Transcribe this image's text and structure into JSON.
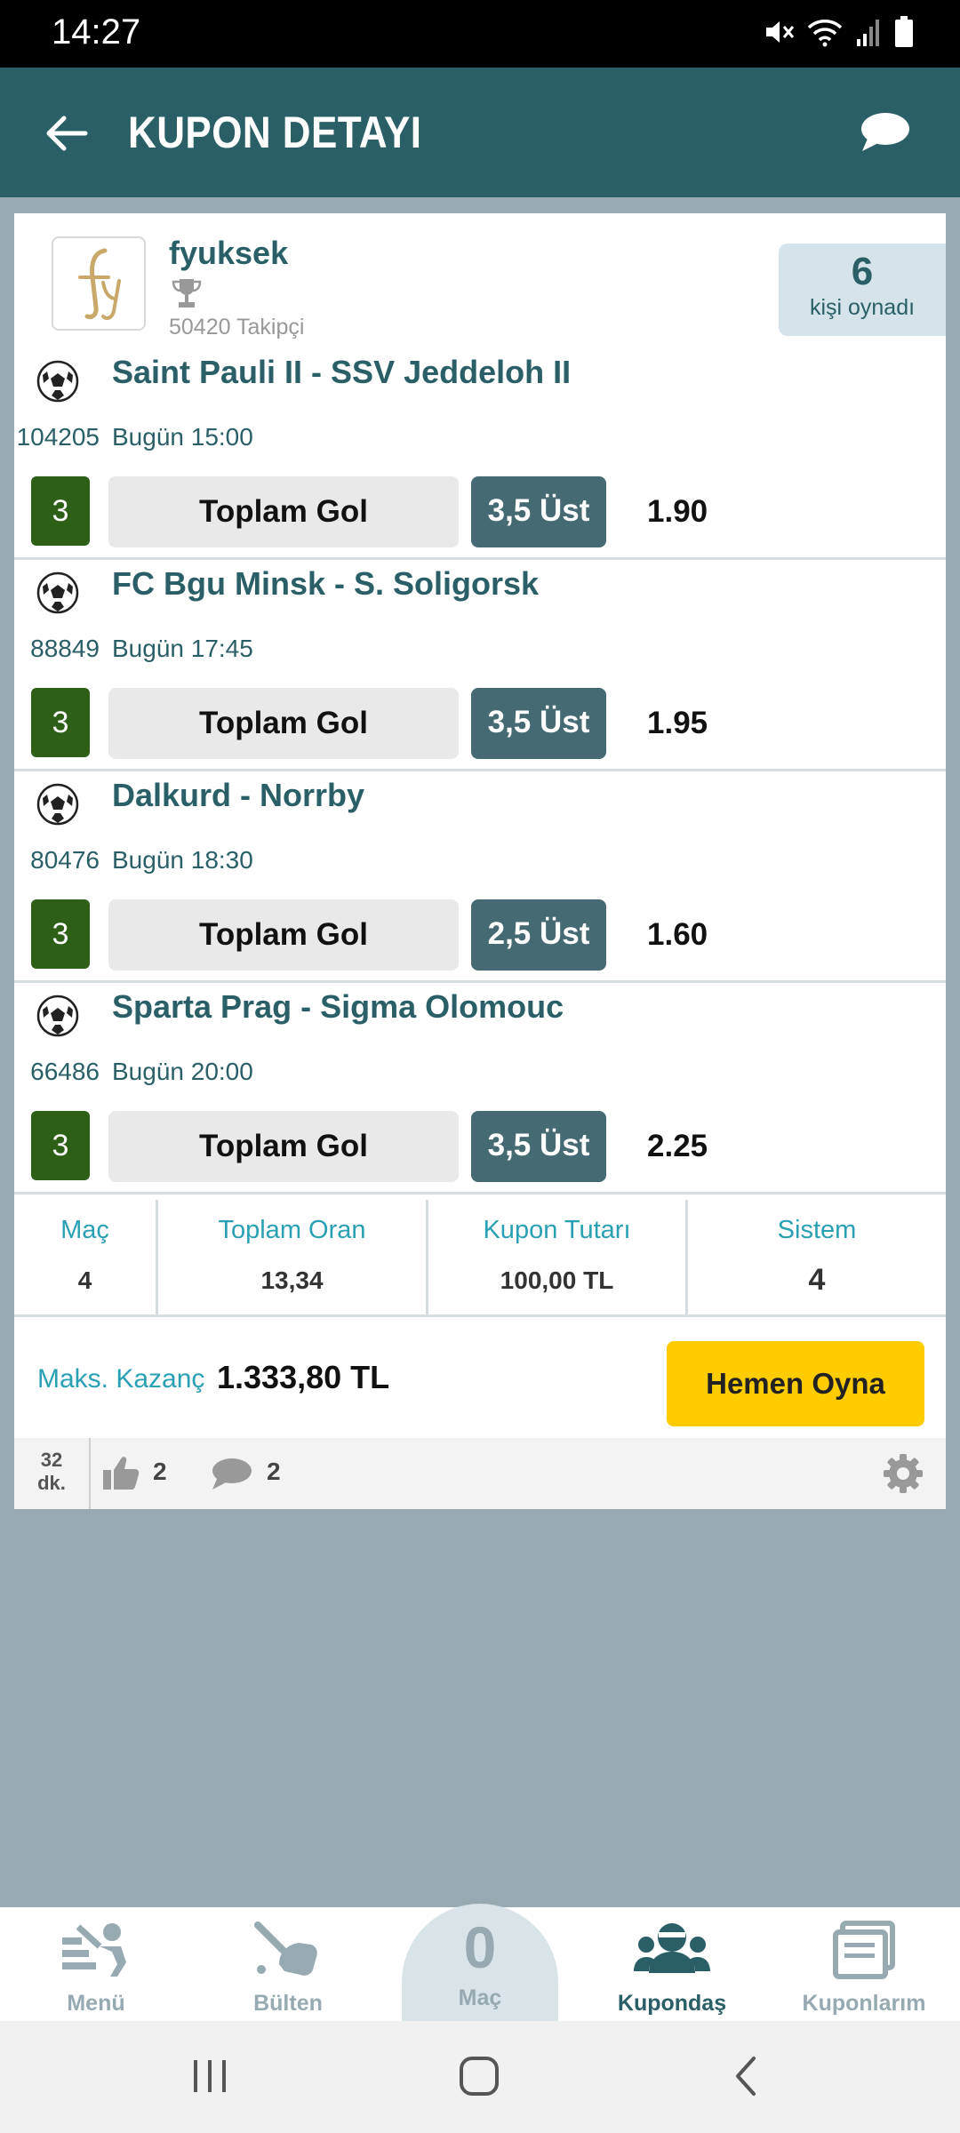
{
  "status_bar": {
    "time": "14:27"
  },
  "header": {
    "title": "KUPON DETAYI"
  },
  "user": {
    "name": "fyuksek",
    "followers": "50420 Takipçi",
    "players_count": "6",
    "players_label": "kişi oynadı"
  },
  "matches": [
    {
      "teams": "Saint Pauli II - SSV Jeddeloh II",
      "code": "104205",
      "time": "Bugün 15:00",
      "mbs": "3",
      "market": "Toplam Gol",
      "pick": "3,5 Üst",
      "odd": "1.90"
    },
    {
      "teams": "FC Bgu Minsk - S. Soligorsk",
      "code": "88849",
      "time": "Bugün 17:45",
      "mbs": "3",
      "market": "Toplam Gol",
      "pick": "3,5 Üst",
      "odd": "1.95"
    },
    {
      "teams": "Dalkurd - Norrby",
      "code": "80476",
      "time": "Bugün 18:30",
      "mbs": "3",
      "market": "Toplam Gol",
      "pick": "2,5 Üst",
      "odd": "1.60"
    },
    {
      "teams": "Sparta Prag - Sigma Olomouc",
      "code": "66486",
      "time": "Bugün 20:00",
      "mbs": "3",
      "market": "Toplam Gol",
      "pick": "3,5 Üst",
      "odd": "2.25"
    }
  ],
  "summary": {
    "mac_label": "Maç",
    "mac_value": "4",
    "oran_label": "Toplam Oran",
    "oran_value": "13,34",
    "tutar_label": "Kupon Tutarı",
    "tutar_value": "100,00 TL",
    "sistem_label": "Sistem",
    "sistem_value": "4"
  },
  "winnings": {
    "label": "Maks. Kazanç",
    "amount": "1.333,80 TL",
    "play_button": "Hemen Oyna"
  },
  "social": {
    "age_value": "32",
    "age_unit": "dk.",
    "likes": "2",
    "comments": "2"
  },
  "bottom_nav": {
    "menu": "Menü",
    "bulten": "Bülten",
    "mac_count": "0",
    "mac_label": "Maç",
    "kupondas": "Kupondaş",
    "kuponlarim": "Kuponlarım"
  },
  "colors": {
    "header": "#2a5f68",
    "accent": "#2aa0b5",
    "mbs": "#2d5f17",
    "pick": "#456a73",
    "play": "#ffcc00",
    "background": "#97a9b1"
  }
}
